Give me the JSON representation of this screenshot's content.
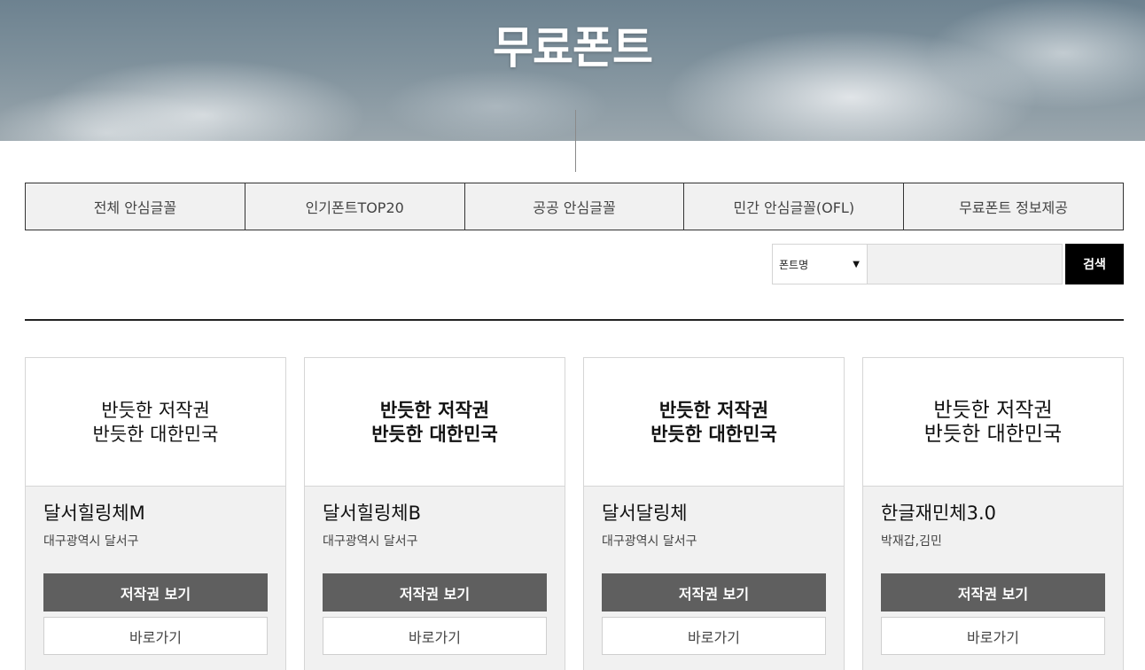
{
  "hero": {
    "title": "무료폰트"
  },
  "tabs": [
    {
      "label": "전체 안심글꼴"
    },
    {
      "label": "인기폰트TOP20"
    },
    {
      "label": "공공 안심글꼴"
    },
    {
      "label": "민간 안심글꼴(OFL)"
    },
    {
      "label": "무료폰트 정보제공"
    }
  ],
  "search": {
    "select_value": "폰트명",
    "input_value": "",
    "button_label": "검색"
  },
  "cards": [
    {
      "preview_line1": "반듯한 저작권",
      "preview_line2": "반듯한 대한민국",
      "name": "달서힐링체M",
      "maker": "대구광역시 달서구",
      "license_label": "저작권 보기",
      "go_label": "바로가기"
    },
    {
      "preview_line1": "반듯한 저작권",
      "preview_line2": "반듯한 대한민국",
      "name": "달서힐링체B",
      "maker": "대구광역시 달서구",
      "license_label": "저작권 보기",
      "go_label": "바로가기"
    },
    {
      "preview_line1": "반듯한 저작권",
      "preview_line2": "반듯한 대한민국",
      "name": "달서달링체",
      "maker": "대구광역시 달서구",
      "license_label": "저작권 보기",
      "go_label": "바로가기"
    },
    {
      "preview_line1": "반듯한 저작권",
      "preview_line2": "반듯한 대한민국",
      "name": "한글재민체3.0",
      "maker": "박재갑,김민",
      "license_label": "저작권 보기",
      "go_label": "바로가기"
    }
  ],
  "colors": {
    "tab_background": "#f1f1f1",
    "search_button": "#000000",
    "license_button": "#5f5f5f",
    "card_background": "#f1f1f1"
  }
}
